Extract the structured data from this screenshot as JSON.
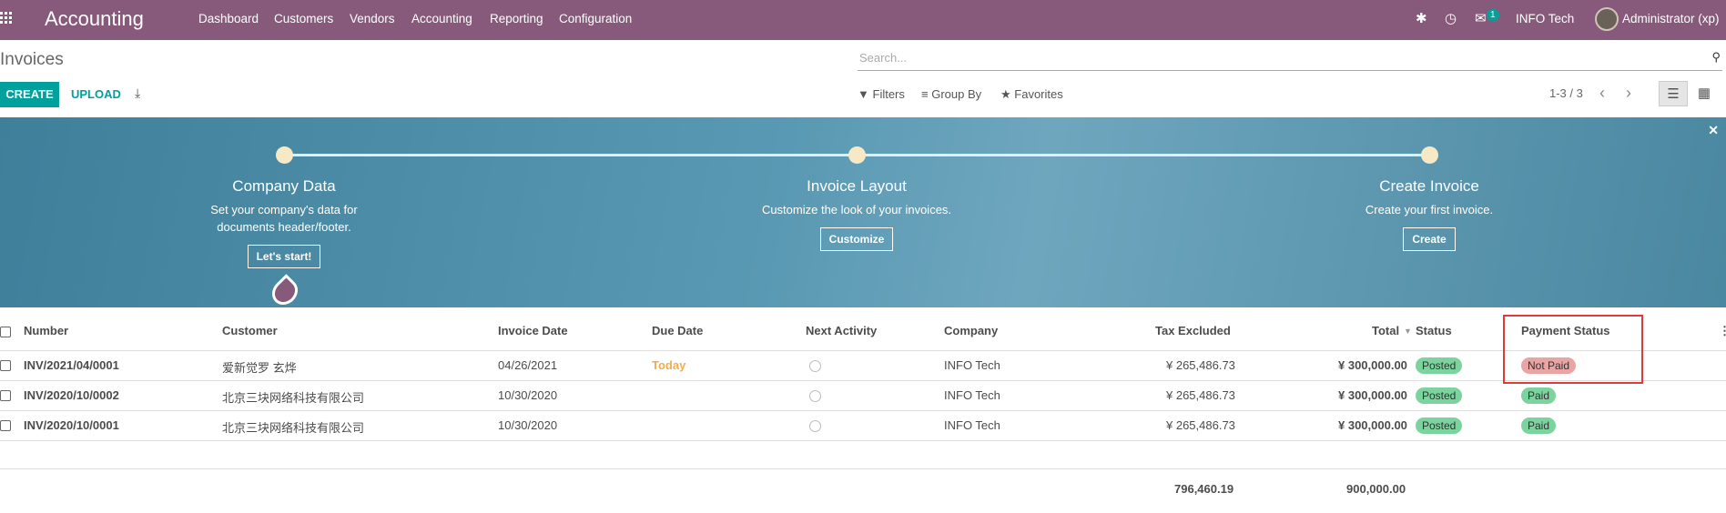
{
  "topbar": {
    "app_name": "Accounting",
    "menu": [
      "Dashboard",
      "Customers",
      "Vendors",
      "Accounting",
      "Reporting",
      "Configuration"
    ],
    "message_count": "1",
    "company": "INFO Tech",
    "user": "Administrator (xp)"
  },
  "page": {
    "title": "Invoices",
    "search_placeholder": "Search...",
    "create_label": "CREATE",
    "upload_label": "UPLOAD",
    "filters_label": "Filters",
    "groupby_label": "Group By",
    "favorites_label": "Favorites",
    "pager": "1-3 / 3"
  },
  "banner": {
    "steps": [
      {
        "title": "Company Data",
        "desc1": "Set your company's data for",
        "desc2": "documents header/footer.",
        "button": "Let's start!"
      },
      {
        "title": "Invoice Layout",
        "desc1": "Customize the look of your invoices.",
        "desc2": "",
        "button": "Customize"
      },
      {
        "title": "Create Invoice",
        "desc1": "Create your first invoice.",
        "desc2": "",
        "button": "Create"
      }
    ]
  },
  "table": {
    "columns": [
      "Number",
      "Customer",
      "Invoice Date",
      "Due Date",
      "Next Activity",
      "Company",
      "Tax Excluded",
      "Total",
      "Status",
      "Payment Status"
    ],
    "rows": [
      {
        "number": "INV/2021/04/0001",
        "customer": "爱新觉罗 玄烨",
        "invoice_date": "04/26/2021",
        "due_date": "Today",
        "company": "INFO Tech",
        "tax_excluded": "¥ 265,486.73",
        "total": "¥ 300,000.00",
        "status": "Posted",
        "payment_status": "Not Paid"
      },
      {
        "number": "INV/2020/10/0002",
        "customer": "北京三块网络科技有限公司",
        "invoice_date": "10/30/2020",
        "due_date": "",
        "company": "INFO Tech",
        "tax_excluded": "¥ 265,486.73",
        "total": "¥ 300,000.00",
        "status": "Posted",
        "payment_status": "Paid"
      },
      {
        "number": "INV/2020/10/0001",
        "customer": "北京三块网络科技有限公司",
        "invoice_date": "10/30/2020",
        "due_date": "",
        "company": "INFO Tech",
        "tax_excluded": "¥ 265,486.73",
        "total": "¥ 300,000.00",
        "status": "Posted",
        "payment_status": "Paid"
      }
    ],
    "totals": {
      "tax_excluded": "796,460.19",
      "total": "900,000.00"
    }
  },
  "colors": {
    "brand": "#875a7b",
    "primary": "#00a09d",
    "posted": "#7bd39d",
    "not_paid": "#e9a4a4"
  }
}
